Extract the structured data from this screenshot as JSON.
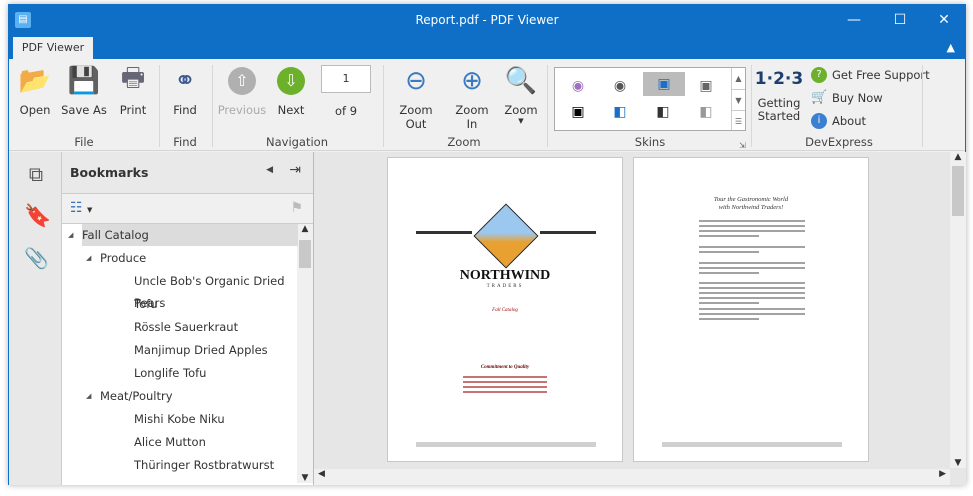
{
  "window": {
    "title": "Report.pdf - PDF Viewer",
    "minimize": "—",
    "maximize": "☐",
    "close": "✕"
  },
  "ribbon": {
    "tab": "PDF Viewer",
    "file": {
      "group": "File",
      "open": "Open",
      "save_as": "Save As",
      "print": "Print"
    },
    "find": {
      "group": "Find",
      "find": "Find"
    },
    "navigation": {
      "group": "Navigation",
      "previous": "Previous",
      "next": "Next",
      "page": "1",
      "of": "of 9"
    },
    "zoom": {
      "group": "Zoom",
      "zoom_out": "Zoom Out",
      "zoom_in": "Zoom In",
      "zoom": "Zoom"
    },
    "skins": {
      "group": "Skins"
    },
    "devexpress": {
      "group": "DevExpress",
      "getting_started": "Getting Started",
      "getting_started_icon": "1·2·3",
      "support": "Get Free Support",
      "buy": "Buy Now",
      "about": "About"
    }
  },
  "bookmarks": {
    "title": "Bookmarks",
    "items": [
      {
        "label": "Fall Catalog",
        "level": 0,
        "expanded": true,
        "selected": true
      },
      {
        "label": "Produce",
        "level": 1,
        "expanded": true
      },
      {
        "label": "Uncle Bob's Organic Dried Pears",
        "level": 2
      },
      {
        "label": "Tofu",
        "level": 2
      },
      {
        "label": "Rössle Sauerkraut",
        "level": 2
      },
      {
        "label": "Manjimup Dried Apples",
        "level": 2
      },
      {
        "label": "Longlife Tofu",
        "level": 2
      },
      {
        "label": "Meat/Poultry",
        "level": 1,
        "expanded": true
      },
      {
        "label": "Mishi Kobe Niku",
        "level": 2
      },
      {
        "label": "Alice Mutton",
        "level": 2
      },
      {
        "label": "Thüringer Rostbratwurst",
        "level": 2
      }
    ]
  },
  "document": {
    "page1": {
      "logo": "NORTHWIND",
      "logo_sub": "TRADERS",
      "subtitle": "Fall Catalog",
      "heading": "Commitment to Quality"
    },
    "page2": {
      "heading1": "Tour the Gastronomic World",
      "heading2": "with Northwind Traders!"
    }
  }
}
